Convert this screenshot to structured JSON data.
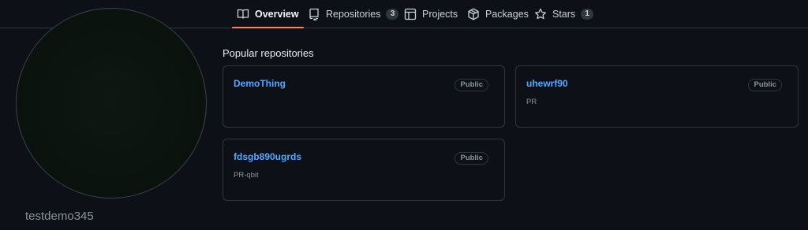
{
  "nav": {
    "tabs": [
      {
        "label": "Overview",
        "icon": "book-icon",
        "active": true
      },
      {
        "label": "Repositories",
        "icon": "repo-icon",
        "count": "3"
      },
      {
        "label": "Projects",
        "icon": "project-icon"
      },
      {
        "label": "Packages",
        "icon": "package-icon"
      },
      {
        "label": "Stars",
        "icon": "star-icon",
        "count": "1"
      }
    ]
  },
  "profile": {
    "username": "testdemo345"
  },
  "popular": {
    "title": "Popular repositories",
    "repos": [
      {
        "name": "DemoThing",
        "visibility": "Public",
        "description": ""
      },
      {
        "name": "uhewrf90",
        "visibility": "Public",
        "description": "PR"
      },
      {
        "name": "fdsgb890ugrds",
        "visibility": "Public",
        "description": "PR-qbit"
      }
    ]
  },
  "colors": {
    "background": "#0d1117",
    "border": "#30363d",
    "link": "#58a6ff",
    "tab_underline": "#f78166"
  }
}
